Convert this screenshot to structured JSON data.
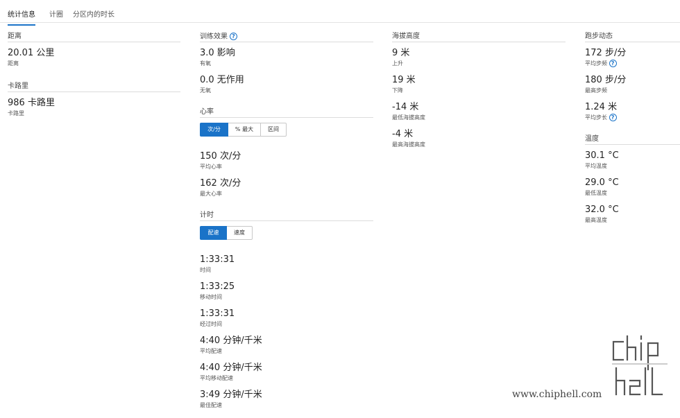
{
  "tabs": [
    "统计信息",
    "计圈",
    "分区内的时长"
  ],
  "distance": {
    "title": "距离",
    "stats": [
      {
        "value": "20.01 公里",
        "label": "距离"
      }
    ]
  },
  "calories": {
    "title": "卡路里",
    "stats": [
      {
        "value": "986 卡路里",
        "label": "卡路里"
      }
    ]
  },
  "training_effect": {
    "title": "训练效果",
    "help_icon": "?",
    "stats": [
      {
        "value": "3.0 影响",
        "label": "有氧"
      },
      {
        "value": "0.0 无作用",
        "label": "无氧"
      }
    ]
  },
  "heart_rate": {
    "title": "心率",
    "toggle": [
      "次/分",
      "% 最大",
      "区间"
    ],
    "stats": [
      {
        "value": "150 次/分",
        "label": "平均心率"
      },
      {
        "value": "162 次/分",
        "label": "最大心率"
      }
    ]
  },
  "timing": {
    "title": "计时",
    "toggle": [
      "配速",
      "速度"
    ],
    "stats": [
      {
        "value": "1:33:31",
        "label": "时间"
      },
      {
        "value": "1:33:25",
        "label": "移动时间"
      },
      {
        "value": "1:33:31",
        "label": "经过时间"
      },
      {
        "value": "4:40 分钟/千米",
        "label": "平均配速"
      },
      {
        "value": "4:40 分钟/千米",
        "label": "平均移动配速"
      },
      {
        "value": "3:49 分钟/千米",
        "label": "最佳配速"
      }
    ]
  },
  "elevation": {
    "title": "海拔高度",
    "stats": [
      {
        "value": "9 米",
        "label": "上升"
      },
      {
        "value": "19 米",
        "label": "下降"
      },
      {
        "value": "-14 米",
        "label": "最低海拔高度"
      },
      {
        "value": "-4 米",
        "label": "最高海拔高度"
      }
    ]
  },
  "running_dynamics": {
    "title": "跑步动态",
    "stats": [
      {
        "value": "172 步/分",
        "label": "平均步频",
        "help": "?"
      },
      {
        "value": "180 步/分",
        "label": "最高步频"
      },
      {
        "value": "1.24 米",
        "label": "平均步长",
        "help": "?"
      }
    ]
  },
  "temperature": {
    "title": "温度",
    "stats": [
      {
        "value": "30.1 °C",
        "label": "平均温度"
      },
      {
        "value": "29.0 °C",
        "label": "最低温度"
      },
      {
        "value": "32.0 °C",
        "label": "最高温度"
      }
    ]
  },
  "watermark": {
    "url": "www.chiphell.com",
    "logo_text": "chip hell"
  },
  "colors": {
    "accent": "#1a73c8",
    "divider": "#dcdcdc"
  }
}
